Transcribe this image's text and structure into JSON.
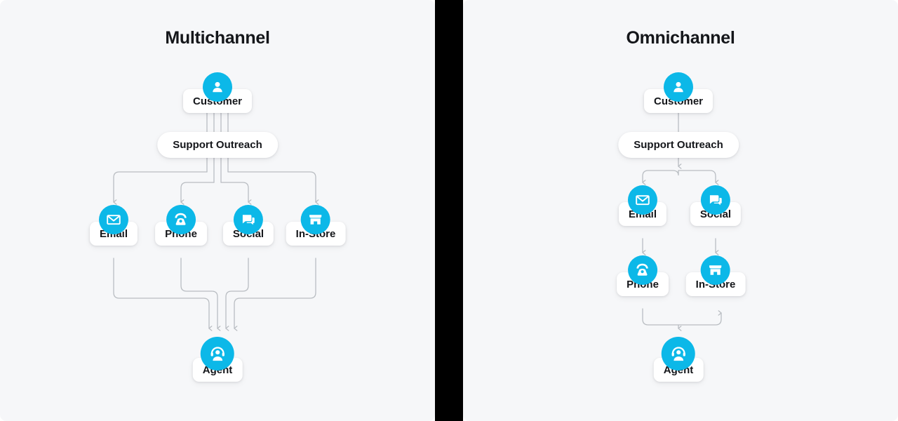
{
  "diagram": {
    "accent_color": "#0cb8e8",
    "panel_bg": "#f6f7f9",
    "divider_color": "#000000",
    "wire_color": "#b9bdc2",
    "text_color": "#14161a"
  },
  "panels": [
    {
      "id": "multichannel",
      "title": "Multichannel",
      "customer": {
        "label": "Customer",
        "icon": "person-icon"
      },
      "outreach": {
        "label": "Support Outreach"
      },
      "agent": {
        "label": "Agent",
        "icon": "headset-agent-icon"
      },
      "channels": [
        {
          "label": "Email",
          "icon": "envelope-icon"
        },
        {
          "label": "Phone",
          "icon": "desk-phone-icon"
        },
        {
          "label": "Social",
          "icon": "chat-bubbles-icon"
        },
        {
          "label": "In-Store",
          "icon": "storefront-icon"
        }
      ]
    },
    {
      "id": "omnichannel",
      "title": "Omnichannel",
      "customer": {
        "label": "Customer",
        "icon": "person-icon"
      },
      "outreach": {
        "label": "Support Outreach"
      },
      "agent": {
        "label": "Agent",
        "icon": "headset-agent-icon"
      },
      "channels": [
        {
          "label": "Email",
          "icon": "envelope-icon"
        },
        {
          "label": "Social",
          "icon": "chat-bubbles-icon"
        },
        {
          "label": "Phone",
          "icon": "desk-phone-icon"
        },
        {
          "label": "In-Store",
          "icon": "storefront-icon"
        }
      ]
    }
  ]
}
